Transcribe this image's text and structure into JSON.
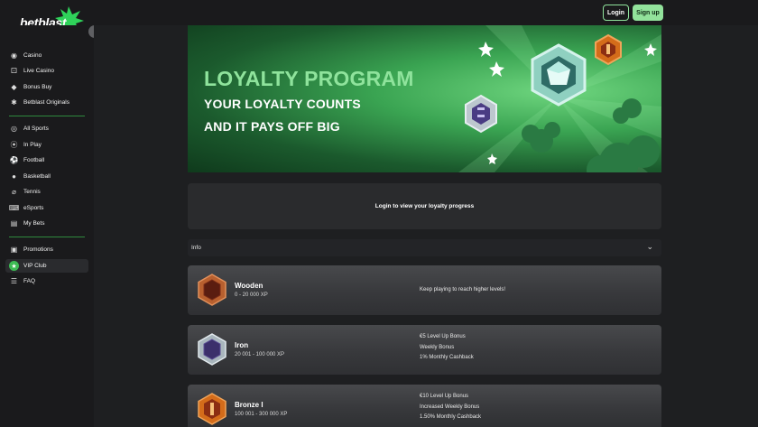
{
  "header": {
    "logo_text": "betblast",
    "login_label": "Login",
    "signup_label": "Sign up",
    "accent_color": "#92e29b"
  },
  "sidebar": {
    "casino_items": [
      {
        "label": "Casino",
        "icon": "casino-chip-icon"
      },
      {
        "label": "Live Casino",
        "icon": "live-casino-icon"
      },
      {
        "label": "Bonus Buy",
        "icon": "diamond-icon"
      },
      {
        "label": "Betblast Originals",
        "icon": "originals-icon"
      }
    ],
    "sport_items": [
      {
        "label": "All Sports",
        "icon": "all-sports-icon"
      },
      {
        "label": "In Play",
        "icon": "in-play-icon"
      },
      {
        "label": "Football",
        "icon": "football-icon"
      },
      {
        "label": "Basketball",
        "icon": "basketball-icon"
      },
      {
        "label": "Tennis",
        "icon": "tennis-icon"
      },
      {
        "label": "eSports",
        "icon": "gamepad-icon"
      },
      {
        "label": "My Bets",
        "icon": "bets-icon"
      }
    ],
    "extra_items": [
      {
        "label": "Promotions",
        "icon": "gift-icon"
      },
      {
        "label": "VIP Club",
        "icon": "star-icon",
        "active": true
      },
      {
        "label": "FAQ",
        "icon": "faq-icon"
      }
    ]
  },
  "banner": {
    "title": "LOYALTY PROGRAM",
    "line1": "YOUR LOYALTY COUNTS",
    "line2": "AND IT PAYS OFF BIG"
  },
  "login_prompt": "Login to view your loyalty progress",
  "info": {
    "label": "Info"
  },
  "levels": [
    {
      "name": "Wooden",
      "xp": "0 - 20 000 XP",
      "perks": [
        "Keep playing to reach higher levels!"
      ],
      "color": "#6b2a18"
    },
    {
      "name": "Iron",
      "xp": "20 001 - 100 000 XP",
      "perks": [
        "€5 Level Up Bonus",
        "Weekly Bonus",
        "1% Monthly Cashback"
      ],
      "color": "#3b2f6b"
    },
    {
      "name": "Bronze I",
      "xp": "100 001 - 300 000 XP",
      "perks": [
        "€10 Level Up Bonus",
        "Increased Weekly Bonus",
        "1.50% Monthly Cashback"
      ],
      "color": "#b5561c"
    }
  ]
}
